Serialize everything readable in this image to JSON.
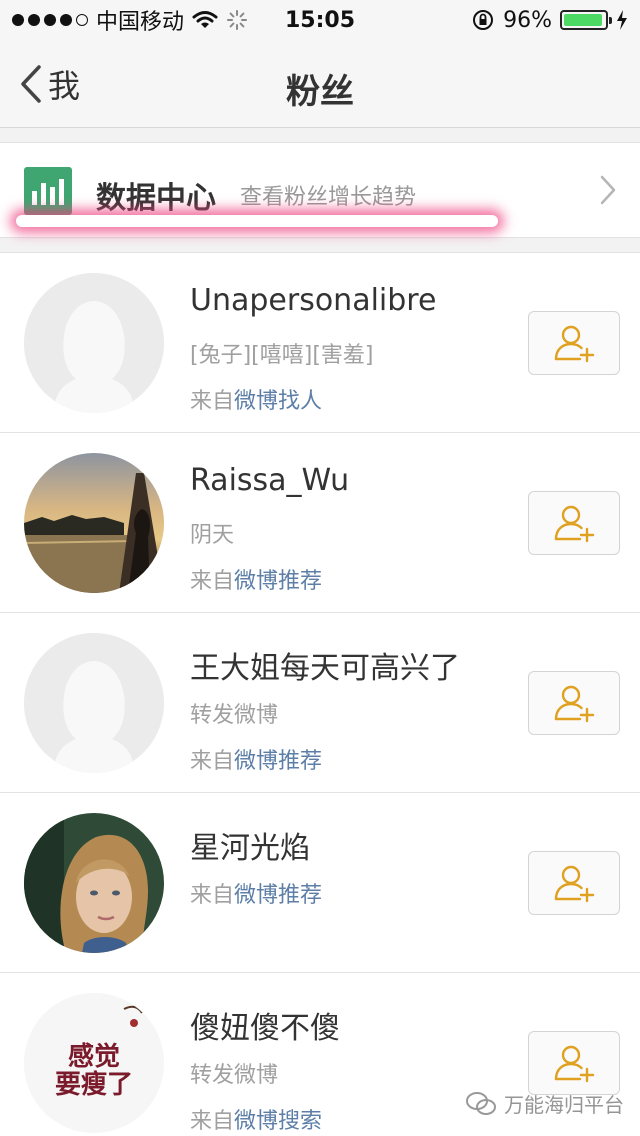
{
  "status_bar": {
    "carrier": "中国移动",
    "time": "15:05",
    "battery_text": "96%",
    "battery_level": 0.96,
    "battery_color": "#4cd964",
    "icons": [
      "signal-dots",
      "wifi-icon",
      "loading-spinner-icon",
      "rotation-lock-icon",
      "battery-icon",
      "charging-bolt-icon"
    ]
  },
  "nav": {
    "back_label": "我",
    "title": "粉丝"
  },
  "data_center": {
    "icon": "bar-chart-icon",
    "title": "数据中心",
    "subtitle": "查看粉丝增长趋势",
    "accent_color": "#3fa672",
    "highlight_color": "#ee4682"
  },
  "followers": [
    {
      "name": "Unapersonalibre",
      "line2": "[兔子][嘻嘻][害羞]",
      "source_prefix": "来自",
      "source_link": "微博找人",
      "avatar": "default-silhouette"
    },
    {
      "name": "Raissa_Wu",
      "line2": "阴天",
      "source_prefix": "来自",
      "source_link": "微博推荐",
      "avatar": "sunset-photo"
    },
    {
      "name": "王大姐每天可高兴了",
      "line2": "转发微博",
      "source_prefix": "来自",
      "source_link": "微博推荐",
      "avatar": "default-silhouette"
    },
    {
      "name": "星河光焰",
      "source_prefix": "来自",
      "source_link": "微博推荐",
      "avatar": "portrait-photo"
    },
    {
      "name": "傻妞傻不傻",
      "line2": "转发微博",
      "source_prefix": "来自",
      "source_link": "微博搜索",
      "avatar": "calligraphy-image",
      "avatar_text": "感觉要瘦了"
    }
  ],
  "follow_button_icon": "add-user-icon",
  "link_color": "#5d7fa7",
  "follow_icon_color": "#e0a020",
  "watermark": "万能海归平台"
}
